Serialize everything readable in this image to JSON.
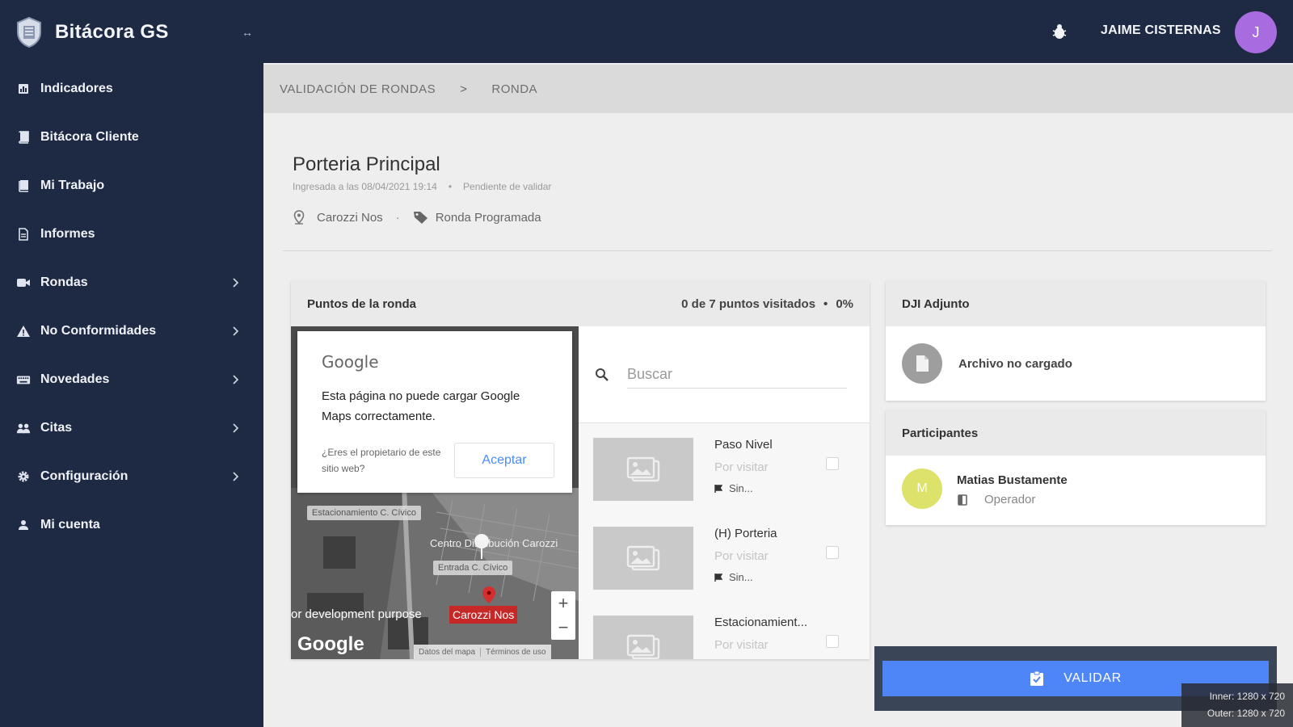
{
  "app": {
    "title": "Bitácora GS"
  },
  "sidebar": {
    "items": [
      {
        "label": "Indicadores",
        "icon": "dashboard-icon",
        "has_submenu": false
      },
      {
        "label": "Bitácora Cliente",
        "icon": "book-icon",
        "has_submenu": false
      },
      {
        "label": "Mi Trabajo",
        "icon": "book-icon",
        "has_submenu": false
      },
      {
        "label": "Informes",
        "icon": "document-icon",
        "has_submenu": false
      },
      {
        "label": "Rondas",
        "icon": "video-camera-icon",
        "has_submenu": true
      },
      {
        "label": "No Conformidades",
        "icon": "warning-icon",
        "has_submenu": true
      },
      {
        "label": "Novedades",
        "icon": "keyboard-icon",
        "has_submenu": true
      },
      {
        "label": "Citas",
        "icon": "users-icon",
        "has_submenu": true
      },
      {
        "label": "Configuración",
        "icon": "gear-icon",
        "has_submenu": true
      },
      {
        "label": "Mi cuenta",
        "icon": "user-icon",
        "has_submenu": false
      }
    ]
  },
  "topbar": {
    "username": "JAIME CISTERNAS",
    "avatar_initial": "J",
    "avatar_color": "#a86ce0"
  },
  "breadcrumb": {
    "items": [
      "VALIDACIÓN DE RONDAS",
      "RONDA"
    ],
    "separator": ">"
  },
  "header": {
    "title": "Porteria Principal",
    "meta_date": "Ingresada a las 08/04/2021 19:14",
    "meta_dot": "•",
    "meta_status": "Pendiente de validar",
    "location": "Carozzi Nos",
    "tag_sep": "·",
    "type": "Ronda Programada"
  },
  "rounds": {
    "title": "Puntos de la ronda",
    "progress_text": "0 de 7 puntos visitados",
    "progress_dot": "•",
    "progress_percent": "0%",
    "search_placeholder": "Buscar",
    "points": [
      {
        "name": "Paso Nivel",
        "status": "Por visitar",
        "extra": "Sin..."
      },
      {
        "name": "(H) Porteria",
        "status": "Por visitar",
        "extra": "Sin..."
      },
      {
        "name": "Estacionamient...",
        "status": "Por visitar",
        "extra": ""
      }
    ]
  },
  "map": {
    "dialog_brand": "Google",
    "dialog_message": "Esta página no puede cargar Google Maps correctamente.",
    "dialog_owner": "¿Eres el propietario de este sitio web?",
    "dialog_accept": "Aceptar",
    "labels": [
      "Estacionamiento C. Cívico",
      "Entrada C. Cívico",
      "Centro Distribución Carozzi"
    ],
    "watermark": "or development purpose",
    "marker_label": "Carozzi Nos",
    "brand": "Google",
    "zoom_in": "+",
    "zoom_out": "−",
    "footer_data": "Datos del mapa",
    "footer_terms": "Términos de uso"
  },
  "dji": {
    "title": "DJI Adjunto",
    "file_status": "Archivo no cargado"
  },
  "participants": {
    "title": "Participantes",
    "list": [
      {
        "initial": "M",
        "name": "Matias Bustamente",
        "role": "Operador",
        "avatar_color": "#dce26a"
      }
    ]
  },
  "actions": {
    "validate": "VALIDAR",
    "accent": "#4f86f7"
  },
  "viewport": {
    "inner": "Inner: 1280 x 720",
    "outer": "Outer: 1280 x 720"
  }
}
